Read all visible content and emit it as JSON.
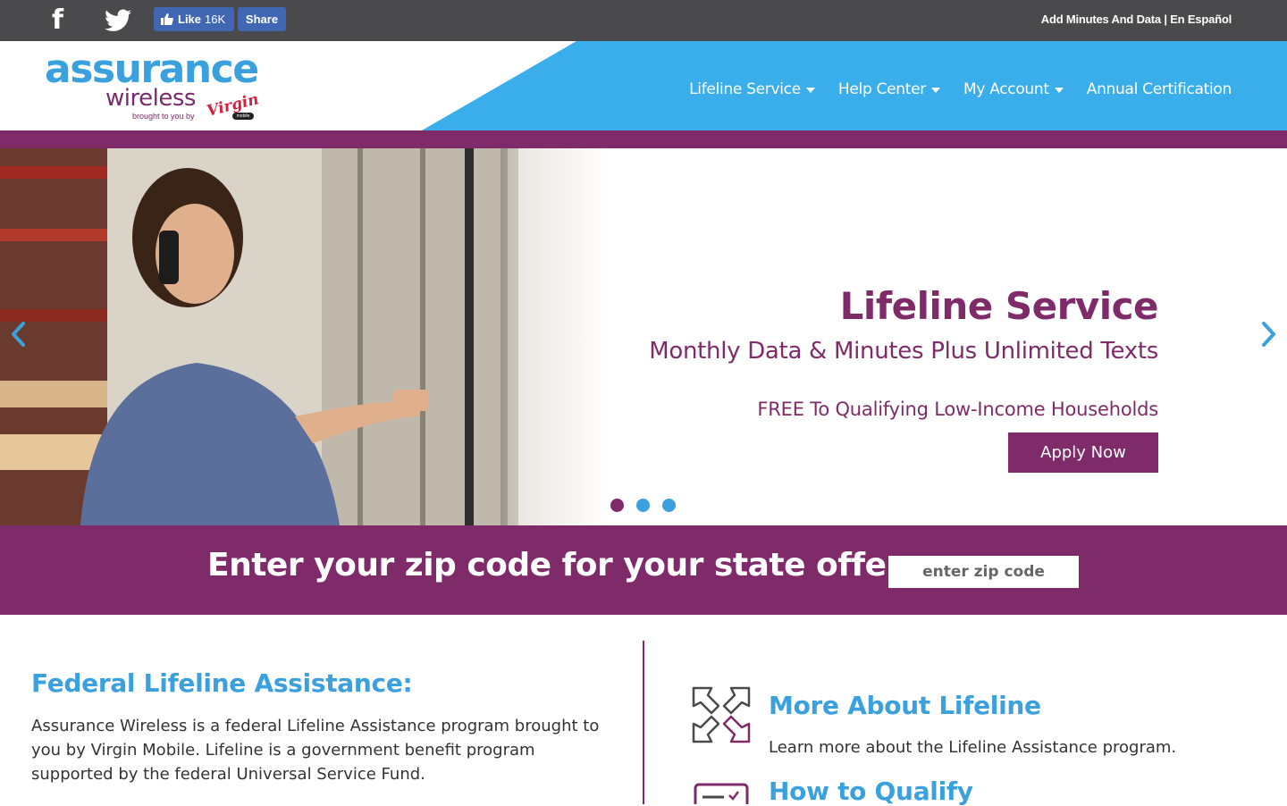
{
  "topbar": {
    "facebook_icon": "facebook-icon",
    "twitter_icon": "twitter-icon",
    "like_label": "Like",
    "like_count": "16K",
    "share_label": "Share",
    "links_text": "Add Minutes And Data | En Español"
  },
  "header": {
    "logo_main": "assurance",
    "logo_sub": "wireless",
    "logo_tagline": "brought to you by",
    "logo_brand": "Virgin",
    "logo_badge": "mobile",
    "nav": [
      {
        "label": "Lifeline Service",
        "has_dropdown": true
      },
      {
        "label": "Help Center",
        "has_dropdown": true
      },
      {
        "label": "My Account",
        "has_dropdown": true
      },
      {
        "label": "Annual Certification",
        "has_dropdown": false
      }
    ]
  },
  "hero": {
    "title": "Lifeline Service",
    "subtitle": "Monthly Data & Minutes Plus Unlimited Texts",
    "free_line": "FREE To Qualifying Low-Income Households",
    "apply_label": "Apply Now",
    "slide_count": 3,
    "active_slide": 1
  },
  "zip": {
    "label": "Enter your zip code for your state offer:",
    "placeholder": "enter zip code",
    "value": ""
  },
  "lower": {
    "left_title": "Federal Lifeline Assistance:",
    "left_text": "Assurance Wireless is a federal Lifeline Assistance program brought to you by Virgin Mobile. Lifeline is a government benefit program supported by the federal Universal Service Fund.",
    "right_items": [
      {
        "title": "More About Lifeline",
        "text": "Learn more about the Lifeline Assistance program.",
        "icon": "arrows-inward-icon"
      },
      {
        "title": "How to Qualify",
        "icon": "checklist-icon"
      }
    ]
  },
  "colors": {
    "brand_purple": "#7f2b69",
    "brand_blue": "#3aa0de",
    "topbar_gray": "#4a4a4c",
    "facebook_blue": "#4267b2"
  }
}
